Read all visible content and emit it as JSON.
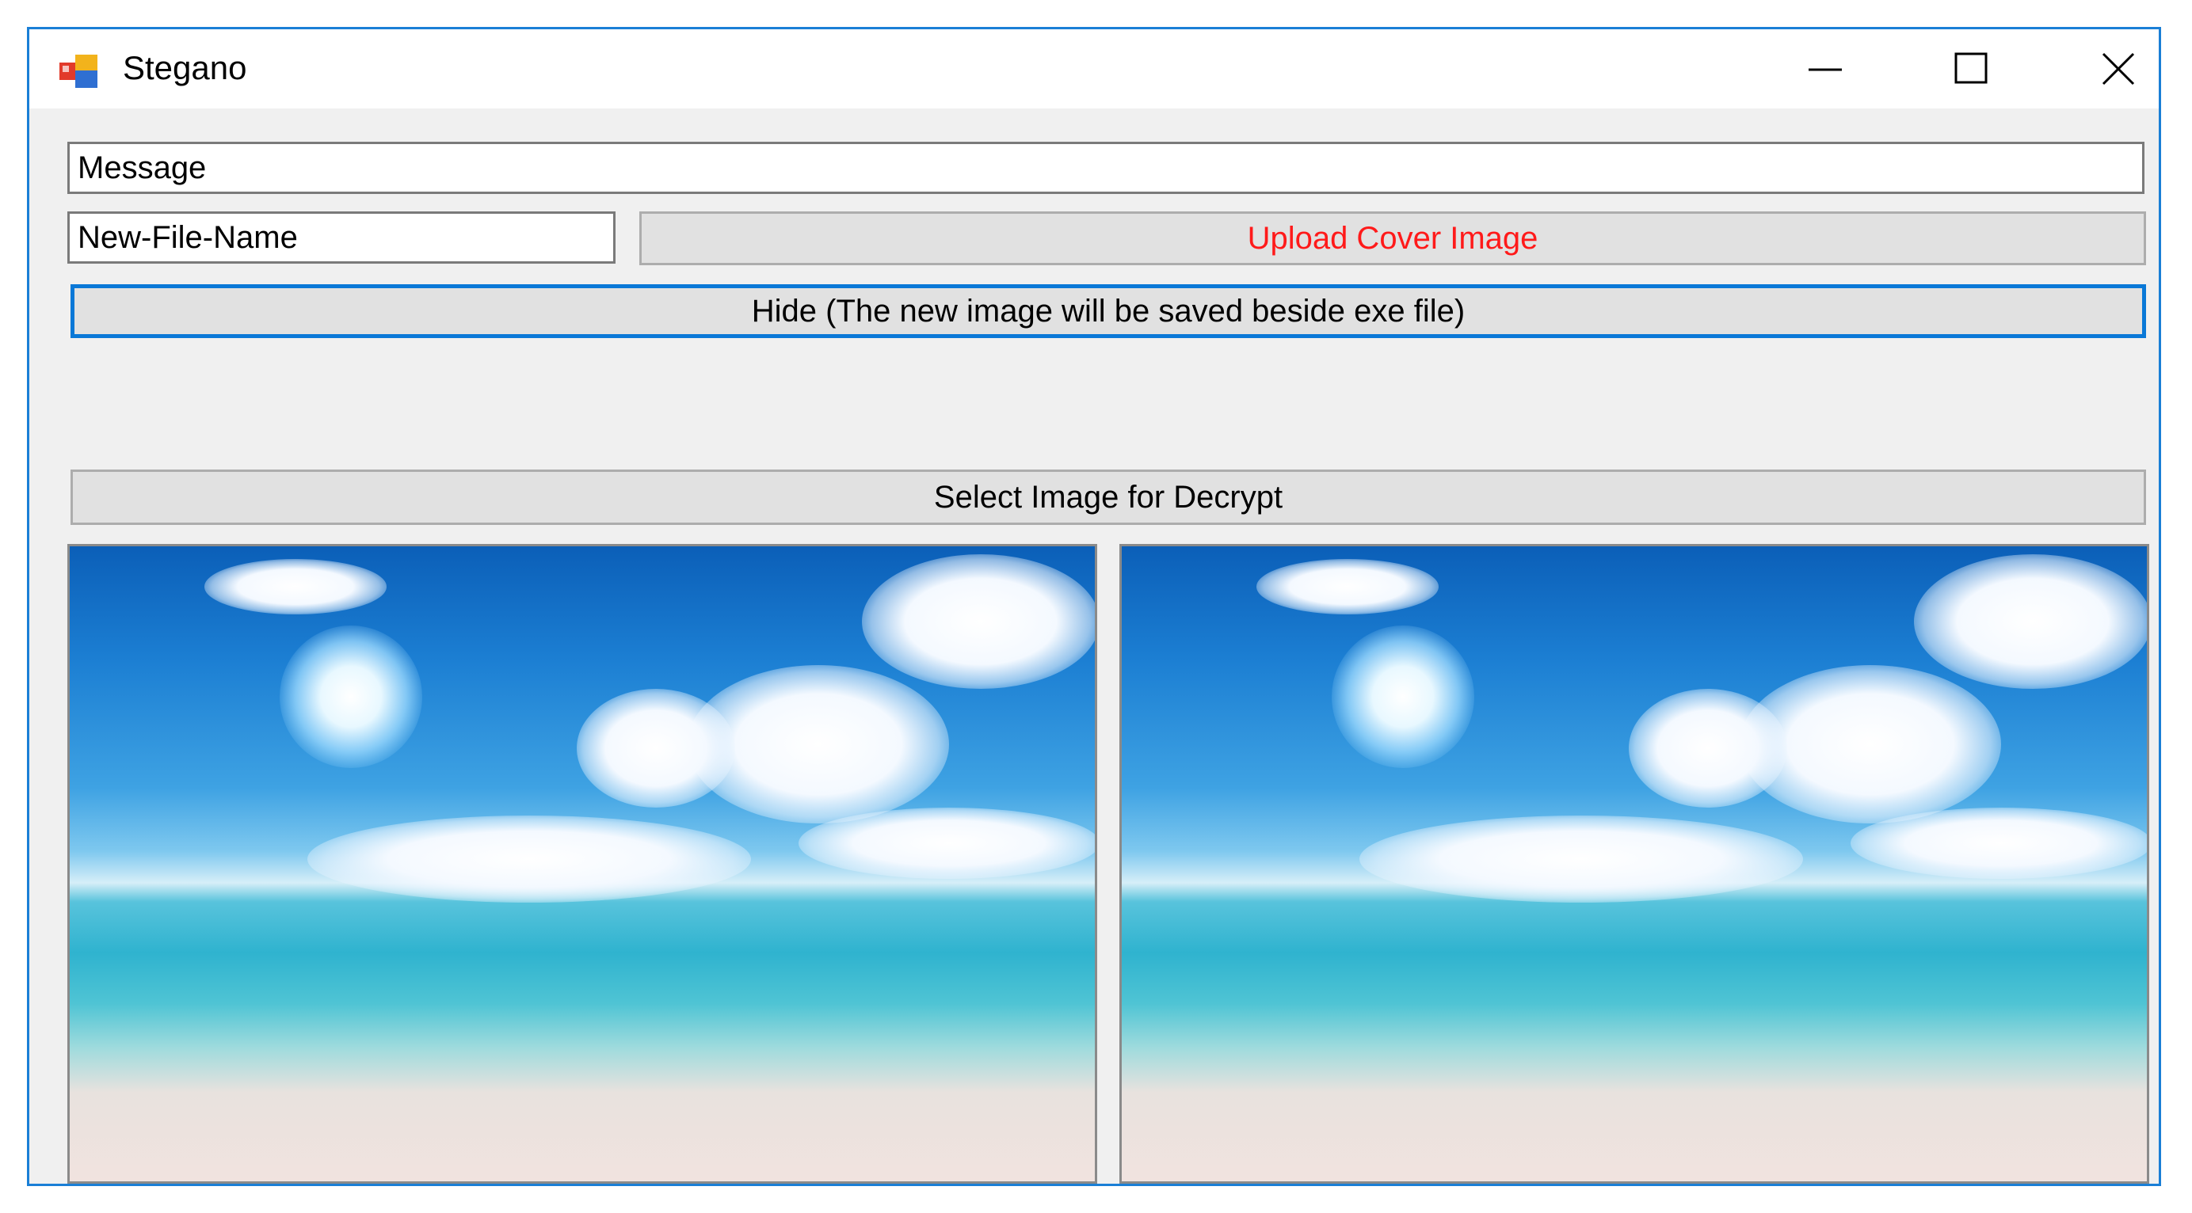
{
  "window": {
    "title": "Stegano"
  },
  "form": {
    "message_value": "Message",
    "filename_value": "New-File-Name",
    "upload_label": "Upload Cover Image",
    "hide_label": "Hide (The new image will be saved beside exe file)",
    "decrypt_label": "Select Image for Decrypt"
  },
  "colors": {
    "upload_text": "#ff0000",
    "focus_border": "#0a78d7",
    "window_border": "#1a7fd6"
  },
  "icons": {
    "app": "app-icon",
    "minimize": "minimize-icon",
    "maximize": "maximize-icon",
    "close": "close-icon"
  }
}
